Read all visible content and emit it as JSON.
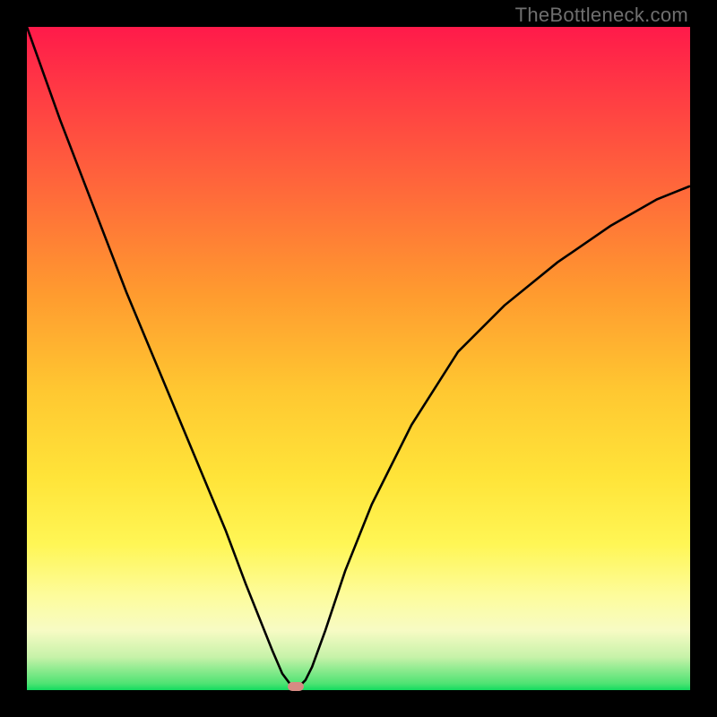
{
  "watermark": "TheBottleneck.com",
  "chart_data": {
    "type": "line",
    "title": "",
    "xlabel": "",
    "ylabel": "",
    "xlim": [
      0,
      100
    ],
    "ylim": [
      0,
      100
    ],
    "series": [
      {
        "name": "curve",
        "x": [
          0,
          5,
          10,
          15,
          20,
          25,
          30,
          33,
          35,
          37,
          38.5,
          40,
          41,
          42,
          43,
          45,
          48,
          52,
          58,
          65,
          72,
          80,
          88,
          95,
          100
        ],
        "y": [
          100,
          86,
          73,
          60,
          48,
          36,
          24,
          16,
          11,
          6,
          2.5,
          0.5,
          0.5,
          1.5,
          3.5,
          9,
          18,
          28,
          40,
          51,
          58,
          64.5,
          70,
          74,
          76
        ]
      }
    ],
    "marker": {
      "x": 40.5,
      "y": 0.5
    },
    "gradient_stops": [
      {
        "pos": 0,
        "color": "#ff1a4a"
      },
      {
        "pos": 25,
        "color": "#ff6a3a"
      },
      {
        "pos": 55,
        "color": "#ffc831"
      },
      {
        "pos": 78,
        "color": "#fff655"
      },
      {
        "pos": 95,
        "color": "#c7f2a9"
      },
      {
        "pos": 100,
        "color": "#13db5f"
      }
    ]
  }
}
